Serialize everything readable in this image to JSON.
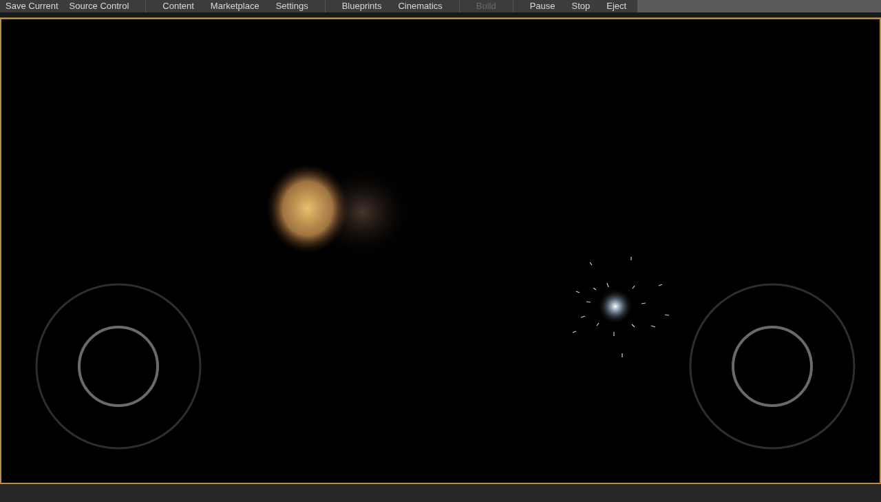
{
  "toolbar": {
    "groups": [
      {
        "buttons": [
          {
            "label": "Save Current",
            "disabled": false
          },
          {
            "label": "Source Control",
            "disabled": false
          }
        ]
      },
      {
        "buttons": [
          {
            "label": "Content",
            "disabled": false
          },
          {
            "label": "Marketplace",
            "disabled": false
          },
          {
            "label": "Settings",
            "disabled": false
          }
        ]
      },
      {
        "buttons": [
          {
            "label": "Blueprints",
            "disabled": false
          },
          {
            "label": "Cinematics",
            "disabled": false
          }
        ]
      },
      {
        "buttons": [
          {
            "label": "Build",
            "disabled": true
          }
        ]
      },
      {
        "buttons": [
          {
            "label": "Pause",
            "disabled": false
          },
          {
            "label": "Stop",
            "disabled": false
          },
          {
            "label": "Eject",
            "disabled": false
          }
        ]
      }
    ]
  }
}
